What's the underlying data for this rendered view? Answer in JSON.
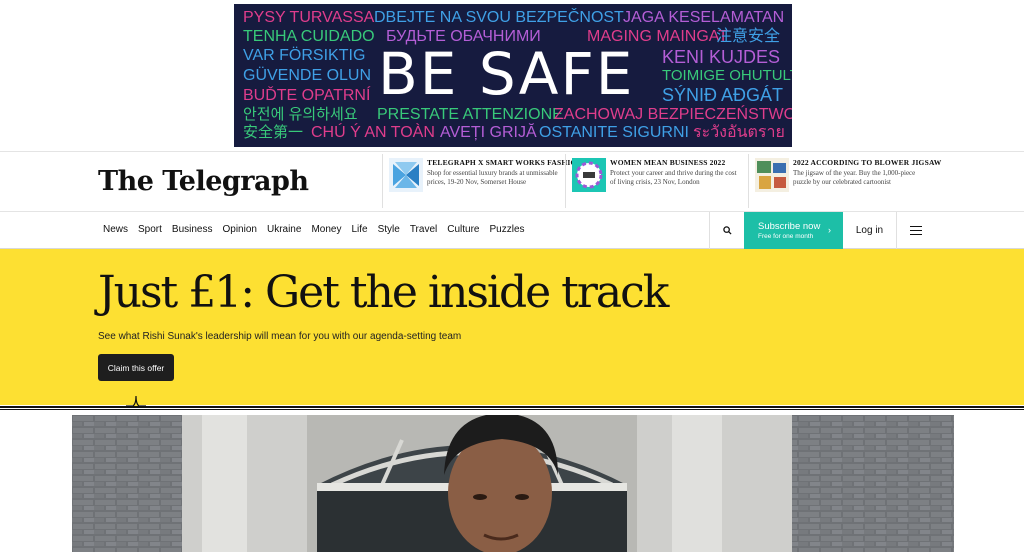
{
  "ad": {
    "headline": "BE SAFE",
    "phrases": [
      "PYSY TURVASSA",
      "DBEJTE NA SVOU BEZPEČNOST",
      "JAGA KESELAMATAN",
      "TENHA CUIDADO",
      "БУДЬТЕ ОБАЧНИМИ",
      "MAGING MAINGAT",
      "注意安全",
      "VAR FÖRSIKTIG",
      "KENI KUJDES",
      "GÜVENDE OLUN",
      "TOIMIGE OHUTULT",
      "BUĎTE OPATRNÍ",
      "SÝNIÐ AÐGÁT",
      "안전에 유의하세요",
      "PRESTATE ATTENZIONE",
      "ZACHOWAJ BEZPIECZEŃSTWO",
      "安全第一",
      "CHÚ Ý AN TOÀN",
      "AVEȚI GRIJĂ",
      "OSTANITE SIGURNI",
      "ระวังอันตราย"
    ]
  },
  "masthead": {
    "logo": "The Telegraph",
    "promos": [
      {
        "title": "TELEGRAPH X SMART WORKS FASHION SALE",
        "desc": "Shop for essential luxury brands at unmissable prices, 19-20 Nov, Somerset House"
      },
      {
        "title": "WOMEN MEAN BUSINESS 2022",
        "desc": "Protect your career and thrive during the cost of living crisis, 23 Nov, London"
      },
      {
        "title": "2022 ACCORDING TO BLOWER JIGSAW",
        "desc": "The jigsaw of the year. Buy the 1,000-piece puzzle by our celebrated cartoonist"
      }
    ]
  },
  "nav": {
    "items": [
      "News",
      "Sport",
      "Business",
      "Opinion",
      "Ukraine",
      "Money",
      "Life",
      "Style",
      "Travel",
      "Culture",
      "Puzzles"
    ],
    "subscribe_label": "Subscribe now",
    "subscribe_sub": "Free for one month",
    "login_label": "Log in"
  },
  "hero": {
    "title": "Just £1: Get the inside track",
    "subtitle": "See what Rishi Sunak's leadership will mean for you with our agenda-setting team",
    "cta": "Claim this offer"
  },
  "colors": {
    "hero_bg": "#fde032",
    "subscribe_bg": "#1dbfa7",
    "ad_bg": "#161b3f"
  }
}
